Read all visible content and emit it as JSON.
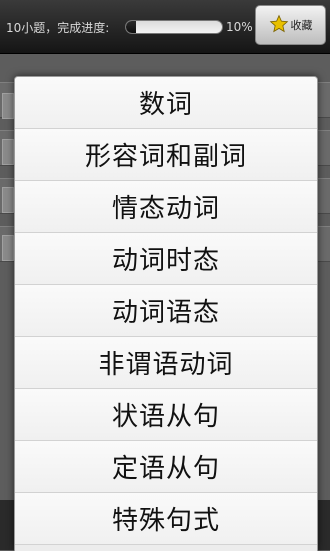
{
  "header": {
    "progress_text": "10小题，完成进度:",
    "progress_value": 0.1,
    "progress_percent": "10%",
    "favorite_label": "收藏",
    "favorite_icon": "star-icon"
  },
  "colors": {
    "accent_star": "#e8c000",
    "progress_fill": "#111111"
  },
  "menu": {
    "items": [
      {
        "label": "数词"
      },
      {
        "label": "形容词和副词"
      },
      {
        "label": "情态动词"
      },
      {
        "label": "动词时态"
      },
      {
        "label": "动词语态"
      },
      {
        "label": "非谓语动词"
      },
      {
        "label": "状语从句"
      },
      {
        "label": "定语从句"
      },
      {
        "label": "特殊句式"
      }
    ]
  }
}
